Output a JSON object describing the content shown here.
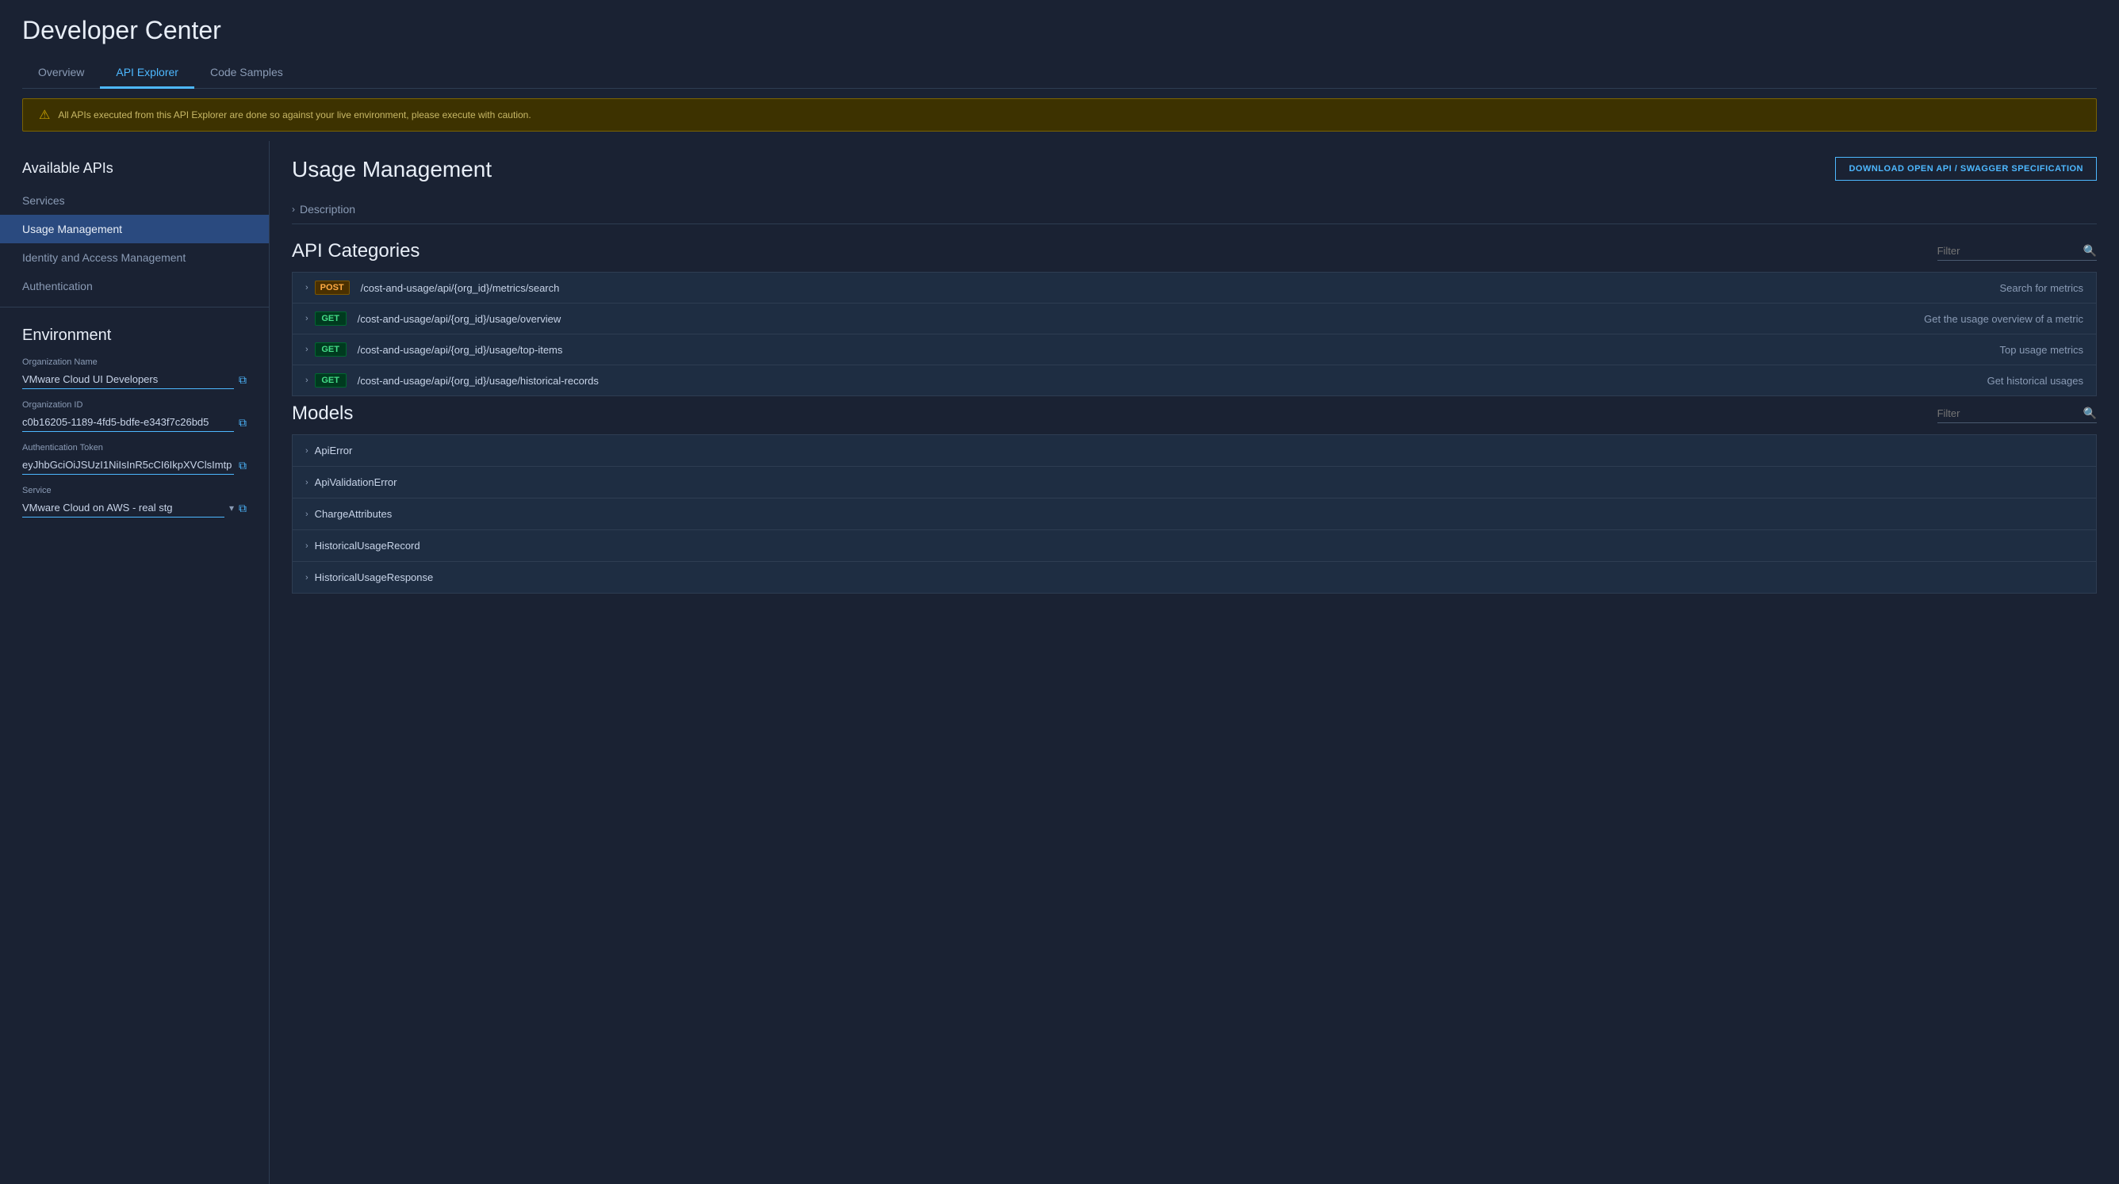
{
  "page": {
    "title": "Developer Center"
  },
  "tabs": {
    "items": [
      {
        "label": "Overview",
        "active": false
      },
      {
        "label": "API Explorer",
        "active": true
      },
      {
        "label": "Code Samples",
        "active": false
      }
    ]
  },
  "warning": {
    "icon": "⚠",
    "text": "All APIs executed from this API Explorer are done so against your live environment, please execute with caution."
  },
  "sidebar": {
    "available_apis_title": "Available APIs",
    "nav_items": [
      {
        "label": "Services",
        "active": false
      },
      {
        "label": "Usage Management",
        "active": true
      },
      {
        "label": "Identity and Access Management",
        "active": false
      },
      {
        "label": "Authentication",
        "active": false
      }
    ],
    "environment_title": "Environment",
    "fields": {
      "org_name_label": "Organization Name",
      "org_name_value": "VMware Cloud UI Developers",
      "org_id_label": "Organization ID",
      "org_id_value": "c0b16205-1189-4fd5-bdfe-e343f7c26bd5",
      "auth_token_label": "Authentication Token",
      "auth_token_value": "eyJhbGciOiJSUzI1NiIsInR5cCI6IkpXVClsImtp",
      "service_label": "Service",
      "service_value": "VMware Cloud on AWS - real stg"
    }
  },
  "content": {
    "title": "Usage Management",
    "download_btn": "DOWNLOAD OPEN API / SWAGGER SPECIFICATION",
    "description_label": "Description",
    "api_categories_title": "API Categories",
    "filter_placeholder": "Filter",
    "apis": [
      {
        "method": "POST",
        "path": "/cost-and-usage/api/{org_id}/metrics/search",
        "description": "Search for metrics"
      },
      {
        "method": "GET",
        "path": "/cost-and-usage/api/{org_id}/usage/overview",
        "description": "Get the usage overview of a metric"
      },
      {
        "method": "GET",
        "path": "/cost-and-usage/api/{org_id}/usage/top-items",
        "description": "Top usage metrics"
      },
      {
        "method": "GET",
        "path": "/cost-and-usage/api/{org_id}/usage/historical-records",
        "description": "Get historical usages"
      }
    ],
    "models_title": "Models",
    "models_filter_placeholder": "Filter",
    "models": [
      {
        "name": "ApiError"
      },
      {
        "name": "ApiValidationError"
      },
      {
        "name": "ChargeAttributes"
      },
      {
        "name": "HistoricalUsageRecord"
      },
      {
        "name": "HistoricalUsageResponse"
      }
    ]
  }
}
